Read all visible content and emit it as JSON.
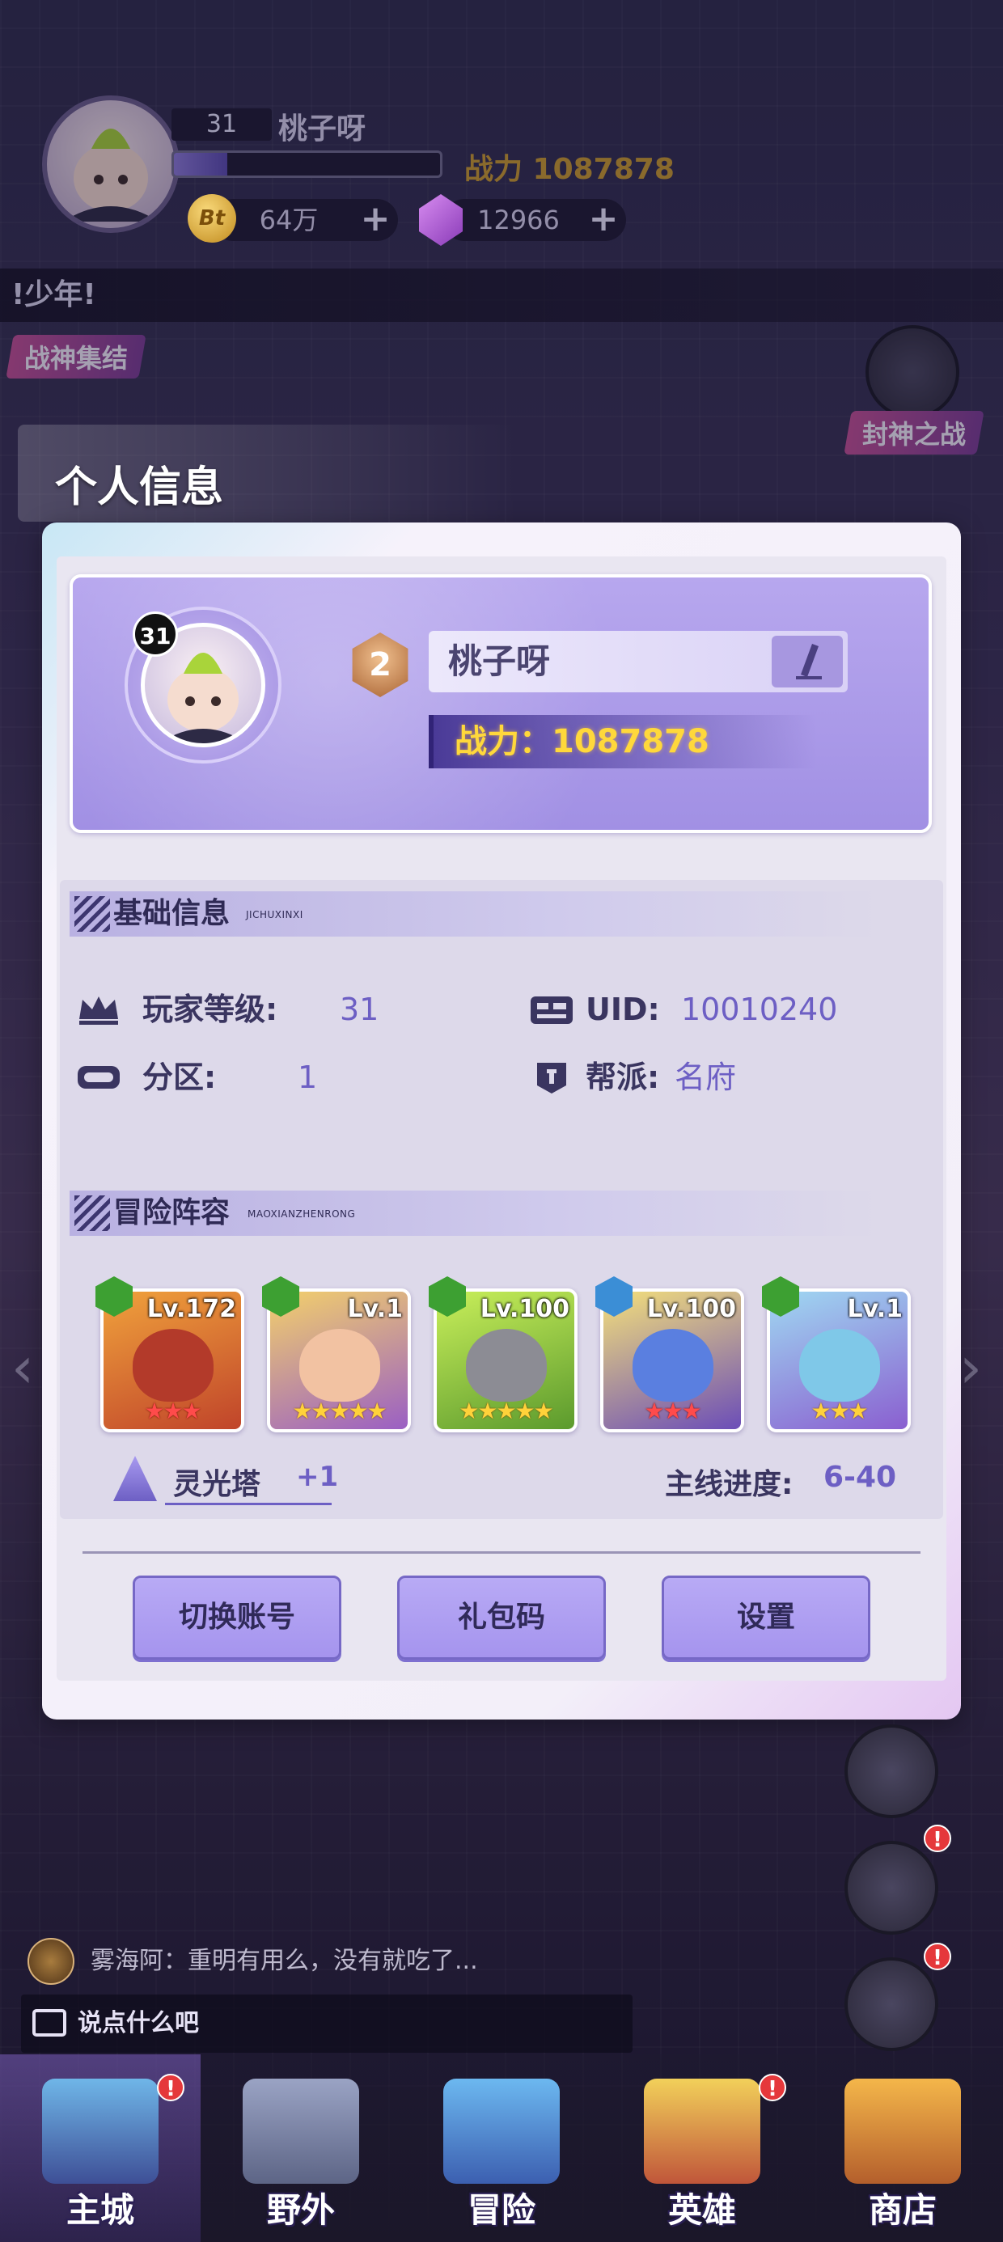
{
  "hud": {
    "level": "31",
    "name": "桃子呀",
    "xp_fraction": 0.2,
    "power": "战力 1087878",
    "coin_symbol": "Bt",
    "coins": "64万",
    "gems": "12966",
    "plus": "+"
  },
  "banner_text": "!少年!",
  "events": {
    "left": "战神集结",
    "right": "封神之战"
  },
  "dialog": {
    "title": "个人信息",
    "profile": {
      "level_badge": "31",
      "rank": "2",
      "name": "桃子呀",
      "power": "战力：1087878"
    },
    "basic": {
      "title": "基础信息",
      "subtitle": "JICHUXINXI",
      "player_level_label": "玩家等级:",
      "player_level_value": "31",
      "uid_label": "UID:",
      "uid_value": "10010240",
      "zone_label": "分区:",
      "zone_value": "1",
      "guild_label": "帮派:",
      "guild_value": "名府"
    },
    "lineup": {
      "title": "冒险阵容",
      "subtitle": "MAOXIANZHENRONG",
      "heroes": [
        {
          "level": "Lv.172",
          "stars": "★★★",
          "star_color": "red"
        },
        {
          "level": "Lv.1",
          "stars": "★★★★★",
          "star_color": "gold"
        },
        {
          "level": "Lv.100",
          "stars": "★★★★★",
          "star_color": "gold"
        },
        {
          "level": "Lv.100",
          "stars": "★★★",
          "star_color": "red"
        },
        {
          "level": "Lv.1",
          "stars": "★★★",
          "star_color": "gold"
        }
      ],
      "tower_label": "灵光塔",
      "tower_value": "+1",
      "progress_label": "主线进度:",
      "progress_value": "6-40"
    },
    "buttons": {
      "switch_account": "切换账号",
      "gift_code": "礼包码",
      "settings": "设置"
    }
  },
  "chat": {
    "message": "雾海阿：重明有用么，没有就吃了...",
    "input_placeholder": "说点什么吧"
  },
  "nav": {
    "items": [
      "主城",
      "野外",
      "冒险",
      "英雄",
      "商店"
    ]
  },
  "alert_mark": "!",
  "colors": {
    "accent": "#6d5fc4",
    "button": "#a594ee",
    "power_gold": "#ffd83b"
  }
}
